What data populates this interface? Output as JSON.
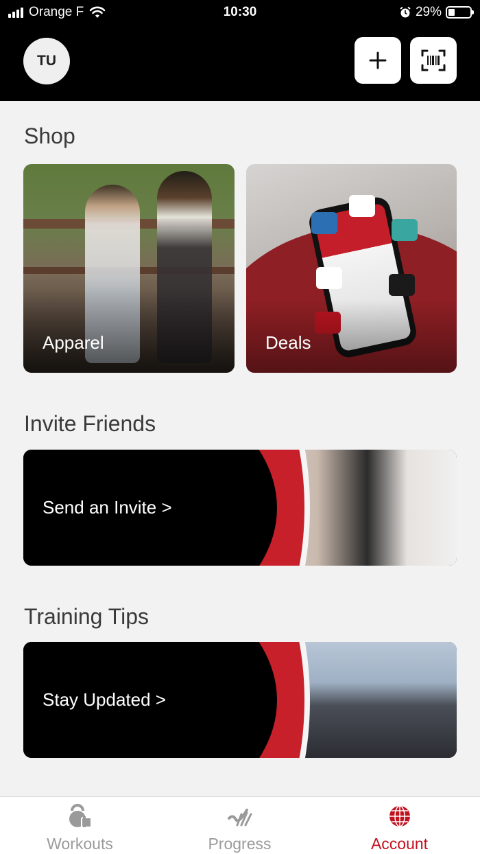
{
  "status_bar": {
    "carrier": "Orange F",
    "time": "10:30",
    "battery_percent": "29%",
    "battery_level": 0.29
  },
  "header": {
    "avatar_initials": "TU",
    "add_icon": "plus-icon",
    "scan_icon": "barcode-scan-icon"
  },
  "shop": {
    "title": "Shop",
    "tiles": [
      {
        "label": "Apparel"
      },
      {
        "label": "Deals"
      }
    ]
  },
  "invite": {
    "title": "Invite Friends",
    "cta": "Send an Invite >"
  },
  "tips": {
    "title": "Training Tips",
    "cta": "Stay Updated >"
  },
  "tabbar": {
    "active": "Account",
    "tabs": [
      {
        "label": "Workouts",
        "icon": "kettlebell-icon"
      },
      {
        "label": "Progress",
        "icon": "progress-chart-icon"
      },
      {
        "label": "Account",
        "icon": "globe-icon"
      }
    ]
  },
  "colors": {
    "brand_red": "#c1121f",
    "header_bg": "#000000",
    "page_bg": "#f2f2f2"
  }
}
